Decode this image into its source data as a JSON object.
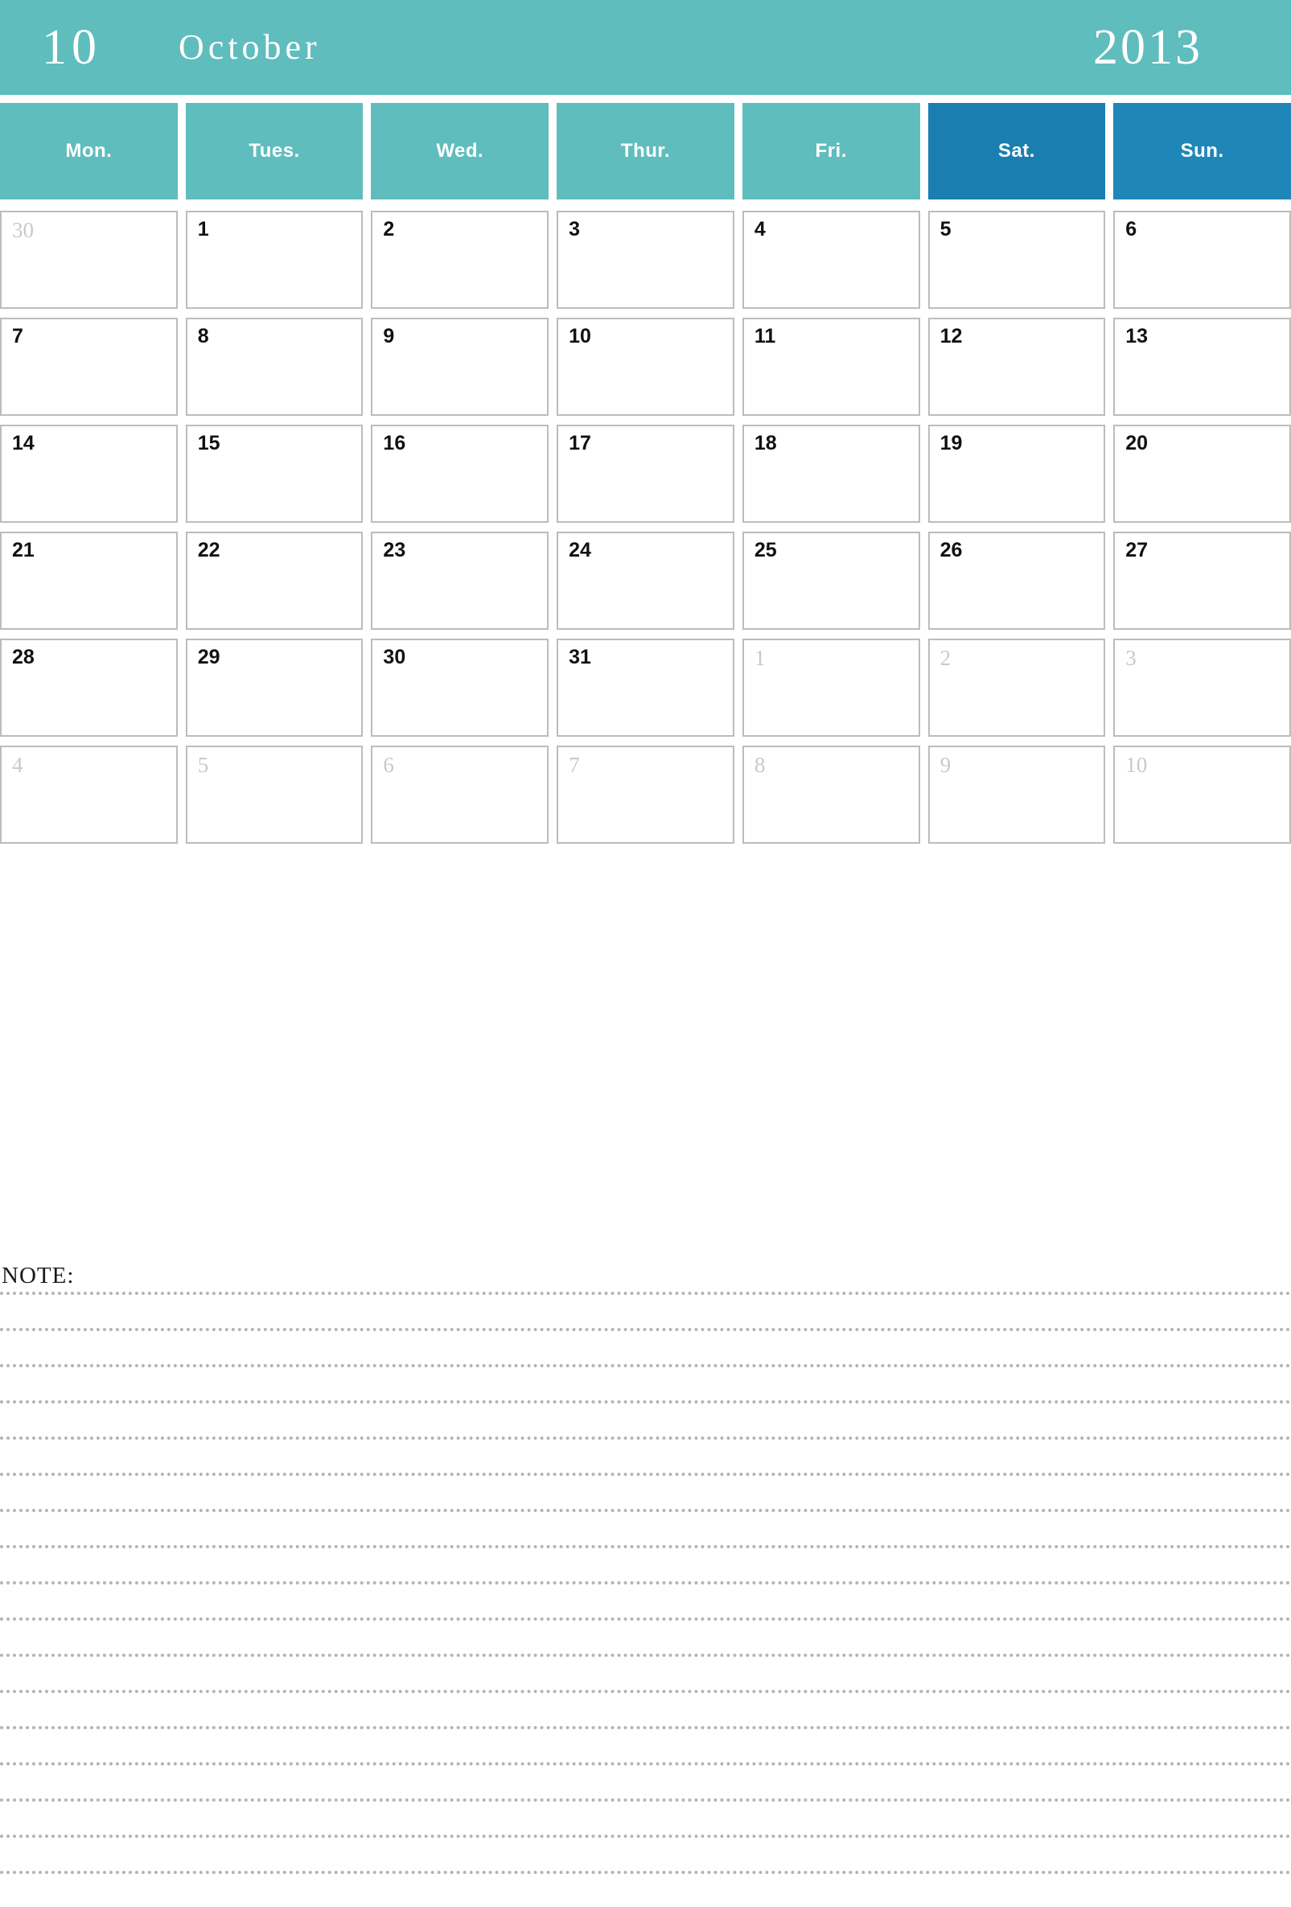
{
  "masthead": {
    "month_number": "10",
    "month_name": "October",
    "year": "2013",
    "background_color": "#5fbdbd",
    "text_color": "#ffffff"
  },
  "colors": {
    "teal": "#5fbdbd",
    "saturday_blue": "#1a7fb0",
    "sunday_blue": "#1f87b8",
    "cell_border": "#bcbcbc",
    "in_month_text": "#111111",
    "out_month_text": "#c9c9c9",
    "note_rule": "#b4b4b4"
  },
  "weekdays": [
    {
      "label": "Mon.",
      "variant": "weekday"
    },
    {
      "label": "Tues.",
      "variant": "weekday"
    },
    {
      "label": "Wed.",
      "variant": "weekday"
    },
    {
      "label": "Thur.",
      "variant": "weekday"
    },
    {
      "label": "Fri.",
      "variant": "weekday"
    },
    {
      "label": "Sat.",
      "variant": "sat"
    },
    {
      "label": "Sun.",
      "variant": "sun"
    }
  ],
  "weeks": [
    [
      {
        "day": "30",
        "in_month": false
      },
      {
        "day": "1",
        "in_month": true
      },
      {
        "day": "2",
        "in_month": true
      },
      {
        "day": "3",
        "in_month": true
      },
      {
        "day": "4",
        "in_month": true
      },
      {
        "day": "5",
        "in_month": true
      },
      {
        "day": "6",
        "in_month": true
      }
    ],
    [
      {
        "day": "7",
        "in_month": true
      },
      {
        "day": "8",
        "in_month": true
      },
      {
        "day": "9",
        "in_month": true
      },
      {
        "day": "10",
        "in_month": true
      },
      {
        "day": "11",
        "in_month": true
      },
      {
        "day": "12",
        "in_month": true
      },
      {
        "day": "13",
        "in_month": true
      }
    ],
    [
      {
        "day": "14",
        "in_month": true
      },
      {
        "day": "15",
        "in_month": true
      },
      {
        "day": "16",
        "in_month": true
      },
      {
        "day": "17",
        "in_month": true
      },
      {
        "day": "18",
        "in_month": true
      },
      {
        "day": "19",
        "in_month": true
      },
      {
        "day": "20",
        "in_month": true
      }
    ],
    [
      {
        "day": "21",
        "in_month": true
      },
      {
        "day": "22",
        "in_month": true
      },
      {
        "day": "23",
        "in_month": true
      },
      {
        "day": "24",
        "in_month": true
      },
      {
        "day": "25",
        "in_month": true
      },
      {
        "day": "26",
        "in_month": true
      },
      {
        "day": "27",
        "in_month": true
      }
    ],
    [
      {
        "day": "28",
        "in_month": true
      },
      {
        "day": "29",
        "in_month": true
      },
      {
        "day": "30",
        "in_month": true
      },
      {
        "day": "31",
        "in_month": true
      },
      {
        "day": "1",
        "in_month": false
      },
      {
        "day": "2",
        "in_month": false
      },
      {
        "day": "3",
        "in_month": false
      }
    ],
    [
      {
        "day": "4",
        "in_month": false
      },
      {
        "day": "5",
        "in_month": false
      },
      {
        "day": "6",
        "in_month": false
      },
      {
        "day": "7",
        "in_month": false
      },
      {
        "day": "8",
        "in_month": false
      },
      {
        "day": "9",
        "in_month": false
      },
      {
        "day": "10",
        "in_month": false
      }
    ]
  ],
  "note": {
    "label": "NOTE:",
    "line_count": 17
  }
}
